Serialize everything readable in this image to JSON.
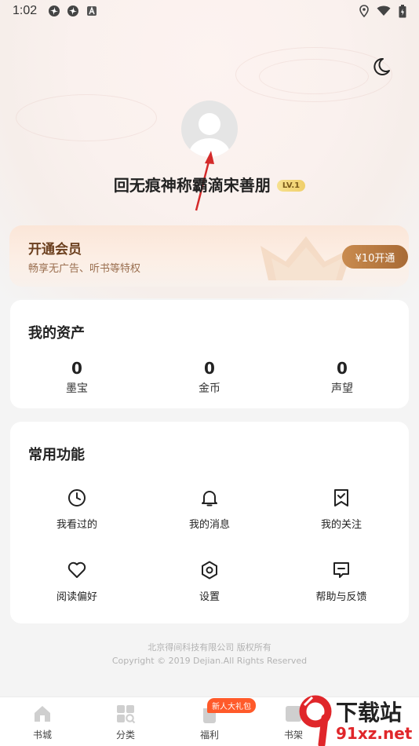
{
  "status_bar": {
    "time": "1:02",
    "left_icons": [
      "pinwheel-icon",
      "pinwheel-icon",
      "a-icon"
    ],
    "right_icons": [
      "location-icon",
      "wifi-icon",
      "battery-icon"
    ]
  },
  "header": {
    "theme_toggle_icon": "moon-icon",
    "avatar_icon": "default-avatar-icon",
    "username": "回无痕神称霸滴宋善朋",
    "level": "LV.1"
  },
  "vip": {
    "title": "开通会员",
    "subtitle": "畅享无广告、听书等特权",
    "button_label": "¥10开通"
  },
  "assets": {
    "title": "我的资产",
    "items": [
      {
        "value": "0",
        "label": "墨宝"
      },
      {
        "value": "0",
        "label": "金币"
      },
      {
        "value": "0",
        "label": "声望"
      }
    ]
  },
  "functions": {
    "title": "常用功能",
    "items": [
      {
        "label": "我看过的",
        "icon": "clock-icon"
      },
      {
        "label": "我的消息",
        "icon": "bell-icon"
      },
      {
        "label": "我的关注",
        "icon": "bookmark-icon"
      },
      {
        "label": "阅读偏好",
        "icon": "heart-icon"
      },
      {
        "label": "设置",
        "icon": "settings-icon"
      },
      {
        "label": "帮助与反馈",
        "icon": "feedback-icon"
      }
    ]
  },
  "footer": {
    "company": "北京得间科技有限公司  版权所有",
    "copyright": "Copyright © 2019 Dejian.All Rights Reserved"
  },
  "tabbar": {
    "tabs": [
      {
        "label": "书城",
        "icon": "home-icon"
      },
      {
        "label": "分类",
        "icon": "category-icon"
      },
      {
        "label": "福利",
        "icon": "gift-icon"
      },
      {
        "label": "书架",
        "icon": "bookshelf-icon"
      }
    ],
    "welfare_badge": "新人大礼包"
  },
  "watermark": {
    "line1": "下载站",
    "line2": "91xz.net"
  },
  "colors": {
    "accent": "#a86a35",
    "badge": "#ff5a2a",
    "watermark_red": "#e0262a"
  }
}
